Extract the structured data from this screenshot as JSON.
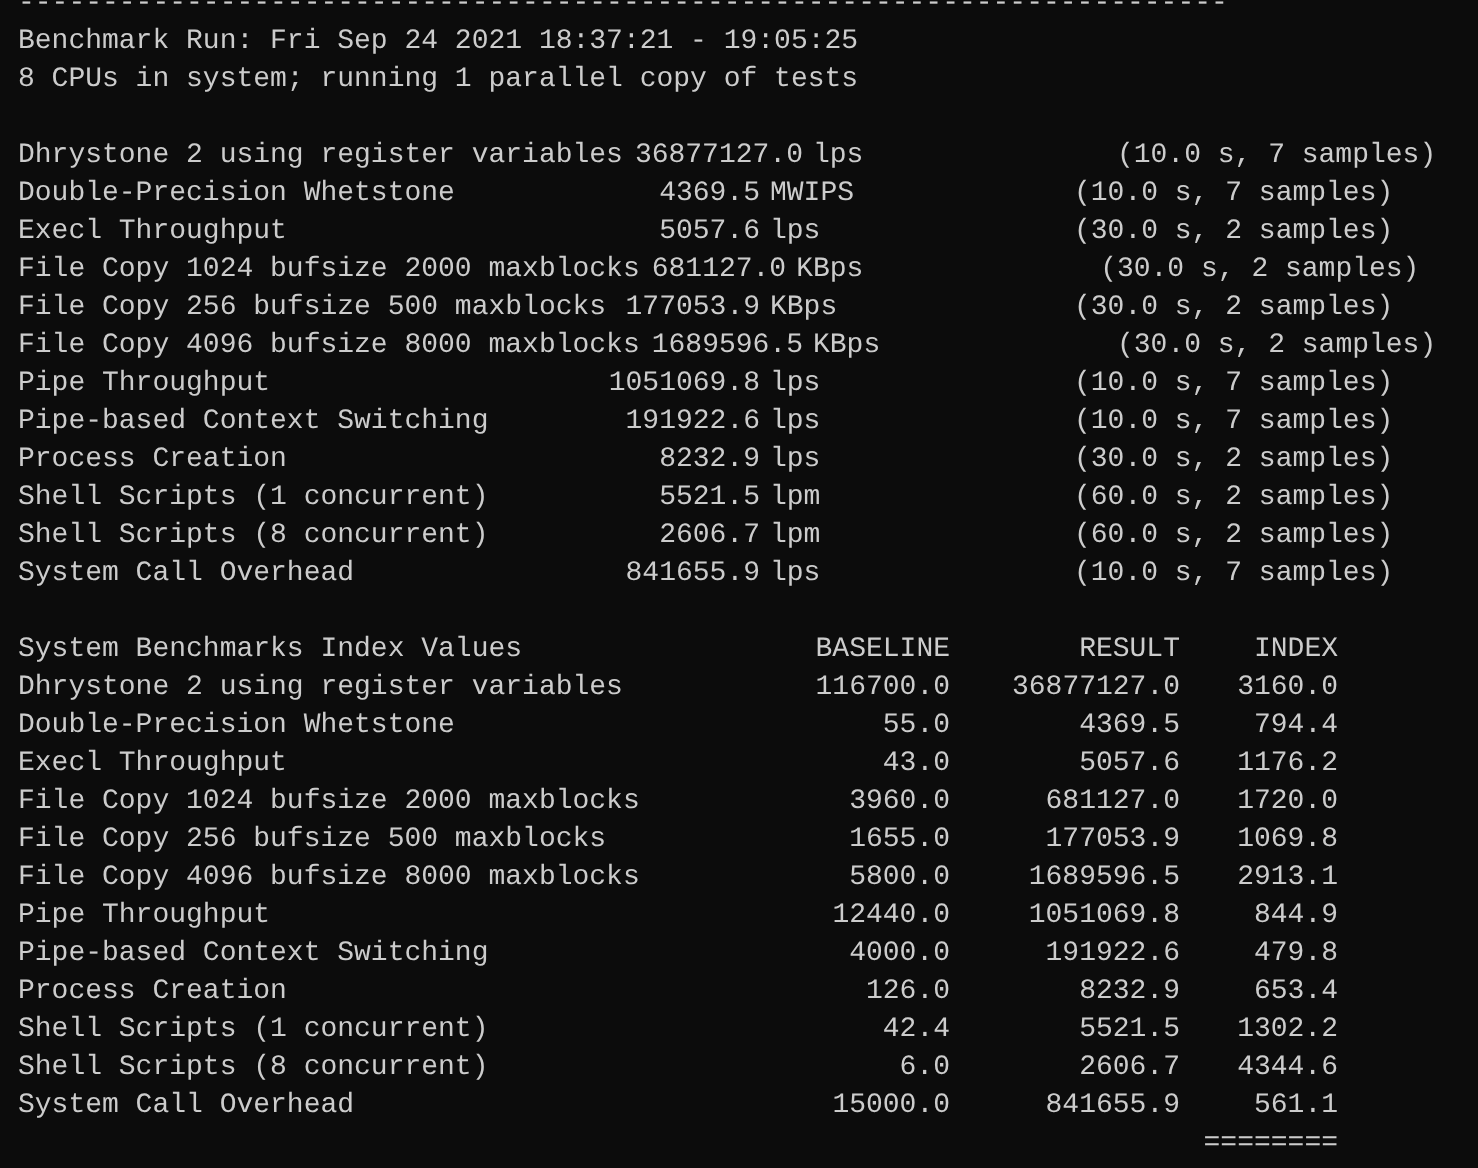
{
  "terminal": {
    "rule": "------------------------------------------------------------------------",
    "run_header": "Benchmark Run: Fri Sep 24 2021 18:37:21 - 19:05:25",
    "cpu_info": "8 CPUs in system; running 1 parallel copy of tests",
    "results": [
      {
        "test": "Dhrystone 2 using register variables",
        "value": "36877127.0",
        "unit": "lps",
        "detail": "(10.0 s, 7 samples)"
      },
      {
        "test": "Double-Precision Whetstone",
        "value": "4369.5",
        "unit": "MWIPS",
        "detail": "(10.0 s, 7 samples)"
      },
      {
        "test": "Execl Throughput",
        "value": "5057.6",
        "unit": "lps",
        "detail": "(30.0 s, 2 samples)"
      },
      {
        "test": "File Copy 1024 bufsize 2000 maxblocks",
        "value": "681127.0",
        "unit": "KBps",
        "detail": "(30.0 s, 2 samples)"
      },
      {
        "test": "File Copy 256 bufsize 500 maxblocks",
        "value": "177053.9",
        "unit": "KBps",
        "detail": "(30.0 s, 2 samples)"
      },
      {
        "test": "File Copy 4096 bufsize 8000 maxblocks",
        "value": "1689596.5",
        "unit": "KBps",
        "detail": "(30.0 s, 2 samples)"
      },
      {
        "test": "Pipe Throughput",
        "value": "1051069.8",
        "unit": "lps",
        "detail": "(10.0 s, 7 samples)"
      },
      {
        "test": "Pipe-based Context Switching",
        "value": "191922.6",
        "unit": "lps",
        "detail": "(10.0 s, 7 samples)"
      },
      {
        "test": "Process Creation",
        "value": "8232.9",
        "unit": "lps",
        "detail": "(30.0 s, 2 samples)"
      },
      {
        "test": "Shell Scripts (1 concurrent)",
        "value": "5521.5",
        "unit": "lpm",
        "detail": "(60.0 s, 2 samples)"
      },
      {
        "test": "Shell Scripts (8 concurrent)",
        "value": "2606.7",
        "unit": "lpm",
        "detail": "(60.0 s, 2 samples)"
      },
      {
        "test": "System Call Overhead",
        "value": "841655.9",
        "unit": "lps",
        "detail": "(10.0 s, 7 samples)"
      }
    ],
    "index": {
      "title": "System Benchmarks Index Values",
      "columns": [
        "BASELINE",
        "RESULT",
        "INDEX"
      ],
      "rows": [
        {
          "test": "Dhrystone 2 using register variables",
          "baseline": "116700.0",
          "result": "36877127.0",
          "index": "3160.0"
        },
        {
          "test": "Double-Precision Whetstone",
          "baseline": "55.0",
          "result": "4369.5",
          "index": "794.4"
        },
        {
          "test": "Execl Throughput",
          "baseline": "43.0",
          "result": "5057.6",
          "index": "1176.2"
        },
        {
          "test": "File Copy 1024 bufsize 2000 maxblocks",
          "baseline": "3960.0",
          "result": "681127.0",
          "index": "1720.0"
        },
        {
          "test": "File Copy 256 bufsize 500 maxblocks",
          "baseline": "1655.0",
          "result": "177053.9",
          "index": "1069.8"
        },
        {
          "test": "File Copy 4096 bufsize 8000 maxblocks",
          "baseline": "5800.0",
          "result": "1689596.5",
          "index": "2913.1"
        },
        {
          "test": "Pipe Throughput",
          "baseline": "12440.0",
          "result": "1051069.8",
          "index": "844.9"
        },
        {
          "test": "Pipe-based Context Switching",
          "baseline": "4000.0",
          "result": "191922.6",
          "index": "479.8"
        },
        {
          "test": "Process Creation",
          "baseline": "126.0",
          "result": "8232.9",
          "index": "653.4"
        },
        {
          "test": "Shell Scripts (1 concurrent)",
          "baseline": "42.4",
          "result": "5521.5",
          "index": "1302.2"
        },
        {
          "test": "Shell Scripts (8 concurrent)",
          "baseline": "6.0",
          "result": "2606.7",
          "index": "4344.6"
        },
        {
          "test": "System Call Overhead",
          "baseline": "15000.0",
          "result": "841655.9",
          "index": "561.1"
        }
      ],
      "total_rule": "========"
    }
  }
}
